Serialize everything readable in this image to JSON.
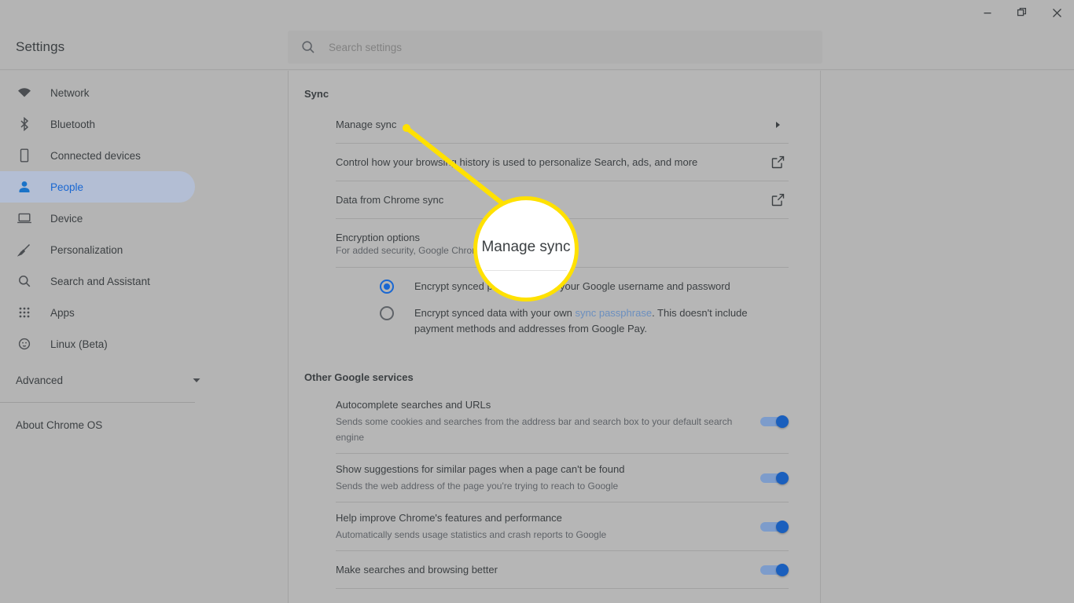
{
  "window": {
    "controls": [
      {
        "name": "minimize-button",
        "glyph": "minimize"
      },
      {
        "name": "restore-button",
        "glyph": "restore"
      },
      {
        "name": "close-button",
        "glyph": "close"
      }
    ]
  },
  "header": {
    "title": "Settings",
    "search": {
      "placeholder": "Search settings",
      "value": "",
      "icon": "search-icon"
    }
  },
  "sidebar": {
    "items": [
      {
        "label": "Network",
        "icon": "wifi-icon",
        "selected": false
      },
      {
        "label": "Bluetooth",
        "icon": "bluetooth-icon",
        "selected": false
      },
      {
        "label": "Connected devices",
        "icon": "phone-icon",
        "selected": false
      },
      {
        "label": "People",
        "icon": "person-icon",
        "selected": true
      },
      {
        "label": "Device",
        "icon": "laptop-icon",
        "selected": false
      },
      {
        "label": "Personalization",
        "icon": "brush-icon",
        "selected": false
      },
      {
        "label": "Search and Assistant",
        "icon": "search-icon",
        "selected": false
      },
      {
        "label": "Apps",
        "icon": "apps-grid-icon",
        "selected": false
      },
      {
        "label": "Linux (Beta)",
        "icon": "linux-penguin-icon",
        "selected": false
      }
    ],
    "advanced": {
      "label": "Advanced",
      "icon": "chevron-down-icon"
    },
    "about": {
      "label": "About Chrome OS"
    }
  },
  "main": {
    "sync": {
      "heading": "Sync",
      "rows": [
        {
          "title": "Manage sync",
          "sub": "",
          "end_icon": "chevron-right-icon"
        },
        {
          "title": "Control how your browsing history is used to personalize Search, ads, and more",
          "sub": "",
          "end_icon": "external-link-icon"
        },
        {
          "title": "Data from Chrome sync",
          "sub": "",
          "end_icon": "external-link-icon"
        }
      ],
      "encryption": {
        "title": "Encryption options",
        "subtitle": "For added security, Google Chrome will encrypt your data",
        "options": [
          {
            "selected": true,
            "text_before": "Encrypt synced passwords with your Google username and password",
            "link": "",
            "text_after": ""
          },
          {
            "selected": false,
            "text_before": "Encrypt synced data with your own ",
            "link": "sync passphrase",
            "text_after": ". This doesn't include payment methods and addresses from Google Pay."
          }
        ]
      }
    },
    "other_google_services": {
      "heading": "Other Google services",
      "rows": [
        {
          "title": "Autocomplete searches and URLs",
          "sub": "Sends some cookies and searches from the address bar and search box to your default search engine",
          "toggle": "on"
        },
        {
          "title": "Show suggestions for similar pages when a page can't be found",
          "sub": "Sends the web address of the page you're trying to reach to Google",
          "toggle": "on"
        },
        {
          "title": "Help improve Chrome's features and performance",
          "sub": "Automatically sends usage statistics and crash reports to Google",
          "toggle": "on"
        },
        {
          "title": "Make searches and browsing better",
          "sub": "",
          "toggle": "on"
        }
      ]
    }
  },
  "annotation": {
    "magnifier_text": "Manage sync",
    "accent_color": "#ffe100",
    "target_label": "Manage sync"
  },
  "colors": {
    "page_background": "#b4b4b4",
    "card_background": "#b6b6b6",
    "selected_nav": "#b3bed4",
    "accent_blue": "#1967d2",
    "toggle_on": "#1a5fbd",
    "link": "#6b8fbf",
    "callout_yellow": "#ffe100"
  }
}
